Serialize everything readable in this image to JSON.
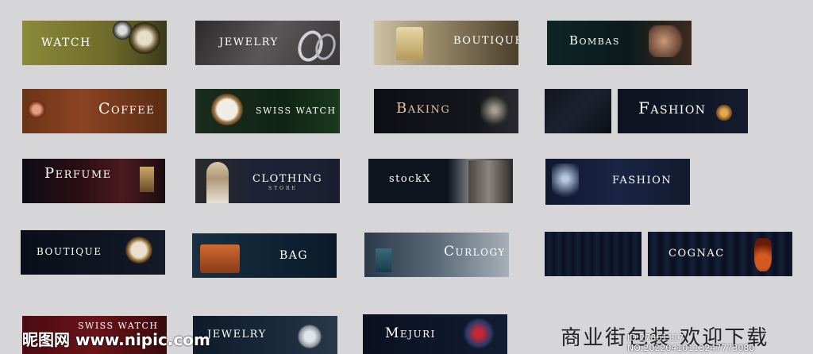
{
  "banners": {
    "watch": "WATCH",
    "jewelry1": "JEWELRY",
    "boutique1": "BOUTIQUE",
    "bombas": "Bombas",
    "coffee": "Coffee",
    "swiss_watch": "SWISS WATCH",
    "baking": "Baking",
    "fashion1": "Fashion",
    "perfume": "Perfume",
    "clothing": "CLOTHING",
    "clothing_sub": "STORE",
    "stockx": "stockX",
    "fashion2": "FASHION",
    "boutique2": "BOUTIQUE",
    "bag": "BAG",
    "curlogy": "Curlogy",
    "cognac": "COGNAC",
    "swiss_watch2": "SWISS WATCH",
    "jewelry2": "JEWELRY",
    "mejuri": "Mejuri"
  },
  "footer": "商业街包装 欢迎下载",
  "watermark": "昵图网 www.nipic.com",
  "watermark_id": "ID:27861117 NO:20220410113247773080",
  "colors": {
    "background": "#d6d6d8"
  }
}
